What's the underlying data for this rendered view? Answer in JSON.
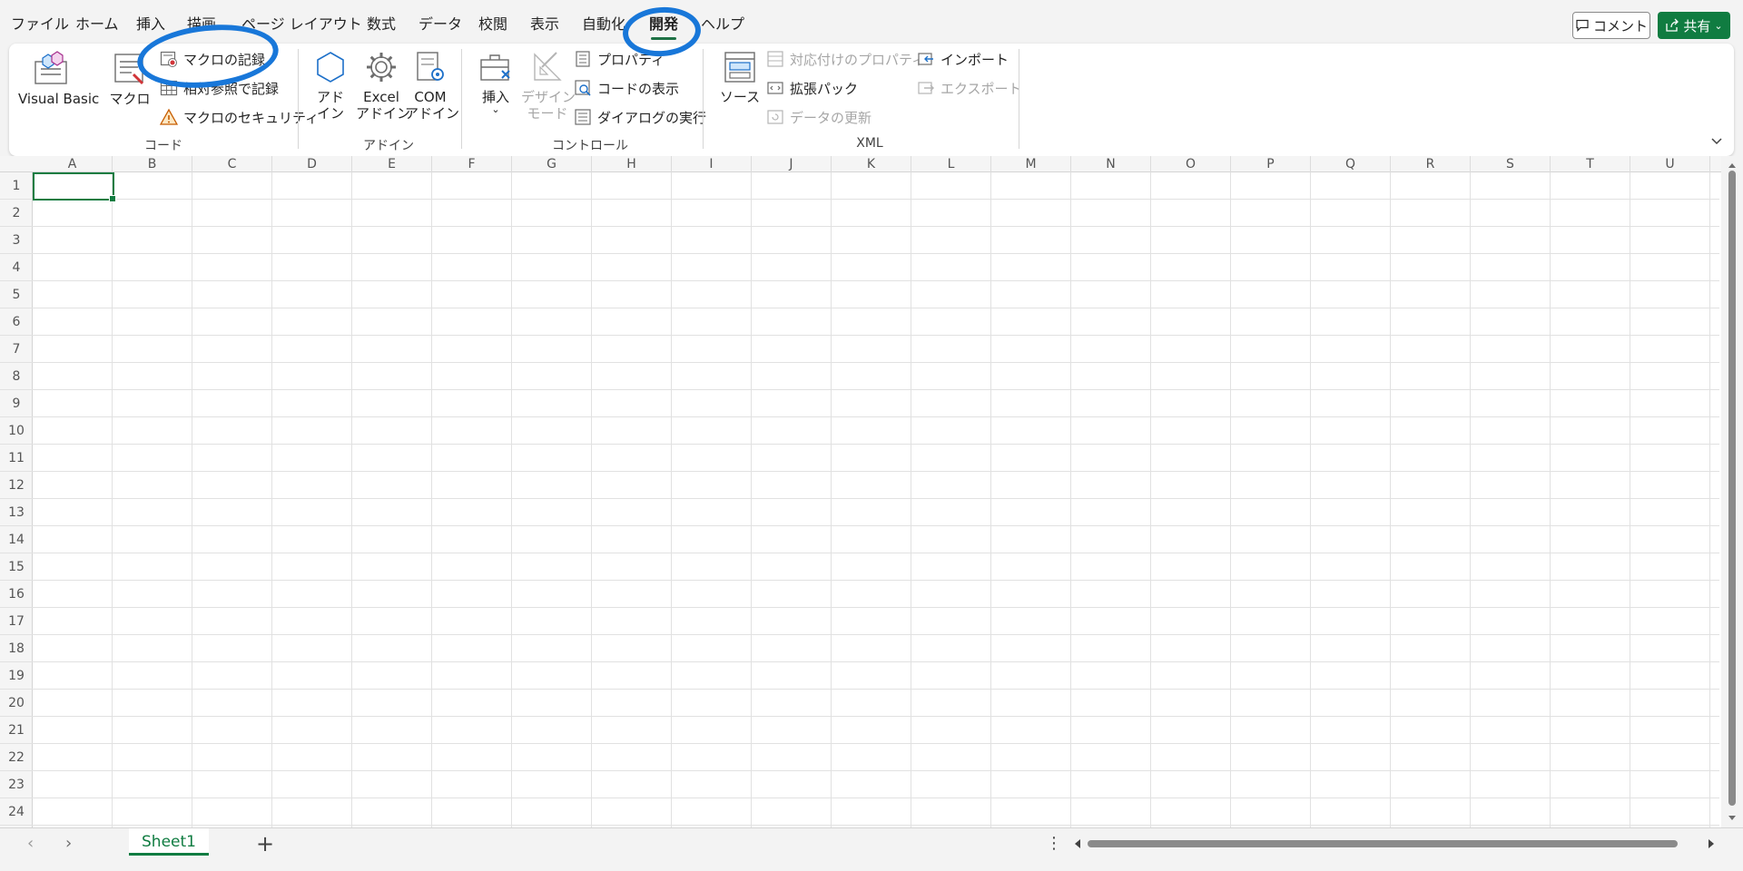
{
  "menu": {
    "tabs": [
      {
        "label": "ファイル"
      },
      {
        "label": "ホーム"
      },
      {
        "label": "挿入"
      },
      {
        "label": "描画"
      },
      {
        "label": "ページ レイアウト"
      },
      {
        "label": "数式"
      },
      {
        "label": "データ"
      },
      {
        "label": "校閲"
      },
      {
        "label": "表示"
      },
      {
        "label": "自動化"
      },
      {
        "label": "開発",
        "active": true
      },
      {
        "label": "ヘルプ"
      }
    ],
    "comment_label": "コメント",
    "share_label": "共有"
  },
  "ribbon": {
    "code": {
      "group_label": "コード",
      "visual_basic": "Visual Basic",
      "macro": "マクロ",
      "record_macro": "マクロの記録",
      "relative_ref": "相対参照で記録",
      "macro_security": "マクロのセキュリティ"
    },
    "addins": {
      "group_label": "アドイン",
      "addin_l1": "アド",
      "addin_l2": "イン",
      "excel_addin_l1": "Excel",
      "excel_addin_l2": "アドイン",
      "com_addin_l1": "COM",
      "com_addin_l2": "アドイン"
    },
    "controls": {
      "group_label": "コントロール",
      "insert": "挿入",
      "design_mode_l1": "デザイン",
      "design_mode_l2": "モード",
      "properties": "プロパティ",
      "view_code": "コードの表示",
      "run_dialog": "ダイアログの実行"
    },
    "xml": {
      "group_label": "XML",
      "source": "ソース",
      "map_properties": "対応付けのプロパティ",
      "expansion_packs": "拡張パック",
      "refresh_data": "データの更新",
      "import": "インポート",
      "export": "エクスポート"
    }
  },
  "grid": {
    "columns": [
      "A",
      "B",
      "C",
      "D",
      "E",
      "F",
      "G",
      "H",
      "I",
      "J",
      "K",
      "L",
      "M",
      "N",
      "O",
      "P",
      "Q",
      "R",
      "S",
      "T",
      "U"
    ],
    "rows": [
      "1",
      "2",
      "3",
      "4",
      "5",
      "6",
      "7",
      "8",
      "9",
      "10",
      "11",
      "12",
      "13",
      "14",
      "15",
      "16",
      "17",
      "18",
      "19",
      "20",
      "21",
      "22",
      "23",
      "24"
    ],
    "active_cell": "A1"
  },
  "sheets": {
    "tabs": [
      "Sheet1"
    ],
    "add_label": "+"
  },
  "colors": {
    "accent": "#107c41",
    "annotation": "#1877d9"
  }
}
